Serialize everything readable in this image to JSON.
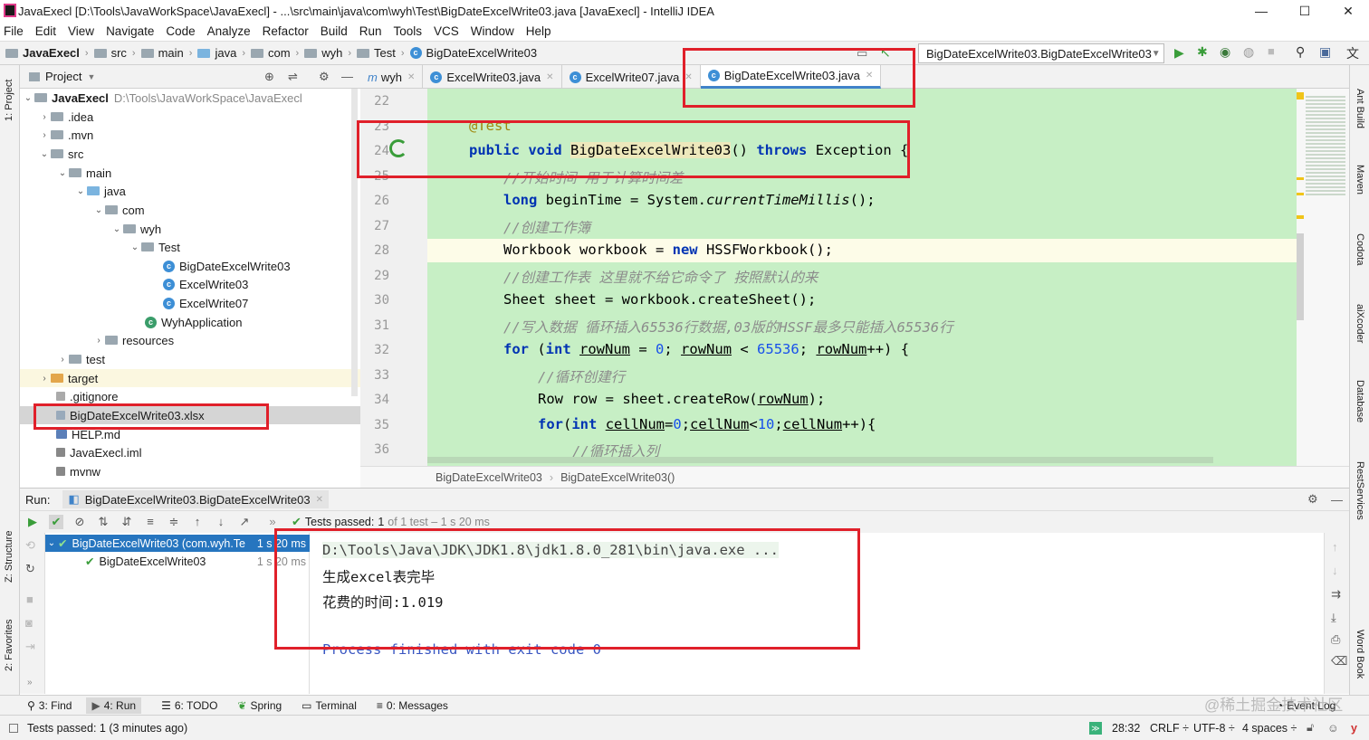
{
  "window": {
    "title": "JavaExecl [D:\\Tools\\JavaWorkSpace\\JavaExecl] - ...\\src\\main\\java\\com\\wyh\\Test\\BigDateExcelWrite03.java [JavaExecl] - IntelliJ IDEA",
    "minimize": "—",
    "maximize": "☐",
    "close": "✕"
  },
  "menu": [
    "File",
    "Edit",
    "View",
    "Navigate",
    "Code",
    "Analyze",
    "Refactor",
    "Build",
    "Run",
    "Tools",
    "VCS",
    "Window",
    "Help"
  ],
  "nav": {
    "crumbs": [
      "JavaExecl",
      "src",
      "main",
      "java",
      "com",
      "wyh",
      "Test",
      "BigDateExcelWrite03"
    ],
    "run_config": "BigDateExcelWrite03.BigDateExcelWrite03"
  },
  "left_strip": {
    "project": "1: Project",
    "structure": "Z: Structure",
    "favorites": "2: Favorites"
  },
  "right_strip": [
    "Ant Build",
    "Maven",
    "Codota",
    "aiXcoder",
    "Database",
    "RestServices",
    "Word Book"
  ],
  "project": {
    "header": "Project",
    "root": "JavaExecl",
    "root_path": "D:\\Tools\\JavaWorkSpace\\JavaExecl",
    "tree": [
      ".idea",
      ".mvn",
      "src",
      "main",
      "java",
      "com",
      "wyh",
      "Test",
      "BigDateExcelWrite03",
      "ExcelWrite03",
      "ExcelWrite07",
      "WyhApplication",
      "resources",
      "test",
      "target",
      ".gitignore",
      "BigDateExcelWrite03.xlsx",
      "HELP.md",
      "JavaExecl.iml",
      "mvnw"
    ]
  },
  "tabs": [
    "wyh",
    "ExcelWrite03.java",
    "ExcelWrite07.java",
    "BigDateExcelWrite03.java"
  ],
  "code": {
    "line_numbers": [
      "22",
      "23",
      "24",
      "25",
      "26",
      "27",
      "28",
      "29",
      "30",
      "31",
      "32",
      "33",
      "34",
      "35",
      "36"
    ],
    "annotation": "@Test",
    "l24": {
      "kw1": "public",
      "kw2": "void",
      "method": "BigDateExcelWrite03",
      "paren": "()",
      "kw3": "throws",
      "rest": "Exception {"
    },
    "l25": "//开始时间 用于计算时间差",
    "l26": {
      "kw": "long",
      "a": " beginTime = System.",
      "b": "currentTimeMillis",
      "c": "();"
    },
    "l27": "//创建工作簿",
    "l28": {
      "a": "Workbook workbook = ",
      "kw": "new",
      "b": " HSSFWorkbook();"
    },
    "l29": "//创建工作表 这里就不给它命令了 按照默认的来",
    "l30": "Sheet sheet = workbook.createSheet();",
    "l31": "//写入数据 循环插入65536行数据,03版的HSSF最多只能插入65536行",
    "l32": {
      "kw1": "for",
      "a": " (",
      "kw2": "int",
      "v1": "rowNum",
      "b": " = ",
      "n1": "0",
      "c": "; ",
      "v2": "rowNum",
      "d": " < ",
      "n2": "65536",
      "e": "; ",
      "v3": "rowNum",
      "f": "++) {"
    },
    "l33": "//循环创建行",
    "l34": {
      "a": "Row row = sheet.createRow(",
      "v": "rowNum",
      "b": ");"
    },
    "l35": {
      "kw1": "for",
      "a": "(",
      "kw2": "int",
      "v1": "cellNum",
      "b": "=",
      "n1": "0",
      "c": ";",
      "v2": "cellNum",
      "d": "<",
      "n2": "10",
      "e": ";",
      "v3": "cellNum",
      "f": "++){"
    },
    "l36": "//循环插入列"
  },
  "editor_breadcrumb": [
    "BigDateExcelWrite03",
    "BigDateExcelWrite03()"
  ],
  "run": {
    "label": "Run:",
    "config": "BigDateExcelWrite03.BigDateExcelWrite03",
    "tests_passed": "Tests passed:",
    "count": "1",
    "of_text": "of 1 test – 1 s 20 ms",
    "tree": [
      {
        "name": "BigDateExcelWrite03 (com.wyh.Te",
        "time": "1 s 20 ms"
      },
      {
        "name": "BigDateExcelWrite03",
        "time": "1 s 20 ms"
      }
    ],
    "console": [
      "D:\\Tools\\Java\\JDK\\JDK1.8\\jdk1.8.0_281\\bin\\java.exe ...",
      "生成excel表完毕",
      "花费的时间:1.019",
      "Process finished with exit code 0"
    ]
  },
  "bottom_tabs": [
    "3: Find",
    "4: Run",
    "6: TODO",
    "Spring",
    "Terminal",
    "0: Messages",
    "Event Log"
  ],
  "status": {
    "msg": "Tests passed: 1 (3 minutes ago)",
    "pos": "28:32",
    "crlf": "CRLF ÷",
    "enc": "UTF-8 ÷",
    "indent": "4 spaces ÷",
    "watermark": "@稀土掘金技术社区"
  },
  "colors": {
    "accent": "#4083c9",
    "code_bg": "#c7efc5",
    "highlight": "#e0202a"
  }
}
